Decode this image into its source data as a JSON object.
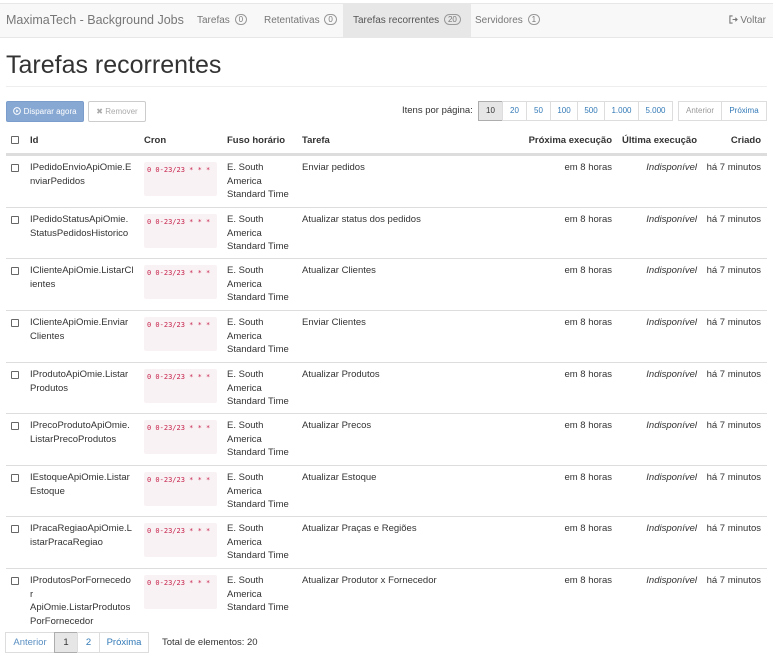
{
  "navbar": {
    "brand": "MaximaTech - Background Jobs",
    "items": [
      {
        "label": "Tarefas",
        "count": "0"
      },
      {
        "label": "Retentativas",
        "count": "0"
      },
      {
        "label": "Tarefas recorrentes",
        "count": "20"
      },
      {
        "label": "Servidores",
        "count": "1"
      }
    ],
    "back_icon": "sign-out-icon",
    "back_label": "Voltar"
  },
  "page": {
    "title": "Tarefas recorrentes"
  },
  "toolbar": {
    "trigger_icon": "play-circle-icon",
    "trigger_label": "Disparar agora",
    "remove_icon": "close-icon",
    "remove_label": "Remover",
    "per_page_label": "Itens por página:",
    "per_page_options": [
      "10",
      "20",
      "50",
      "100",
      "500",
      "1.000",
      "5.000"
    ],
    "per_page_selected": "10",
    "prev_label": "Anterior",
    "next_label": "Próxima"
  },
  "table": {
    "columns": [
      "Id",
      "Cron",
      "Fuso horário",
      "Tarefa",
      "Próxima execução",
      "Última execução",
      "Criado"
    ],
    "rows": [
      {
        "id": "IPedidoEnvioApiOmie.EnviarPedidos",
        "cron": "0 0-23/23 * * *",
        "tz": "E. South America Standard Time",
        "task": "Enviar pedidos",
        "next": "em 8 horas",
        "last": "Indisponível",
        "created": "há 7 minutos"
      },
      {
        "id": "IPedidoStatusApiOmie.StatusPedidosHistorico",
        "cron": "0 0-23/23 * * *",
        "tz": "E. South America Standard Time",
        "task": "Atualizar status dos pedidos",
        "next": "em 8 horas",
        "last": "Indisponível",
        "created": "há 7 minutos"
      },
      {
        "id": "IClienteApiOmie.ListarClientes",
        "cron": "0 0-23/23 * * *",
        "tz": "E. South America Standard Time",
        "task": "Atualizar Clientes",
        "next": "em 8 horas",
        "last": "Indisponível",
        "created": "há 7 minutos"
      },
      {
        "id": "IClienteApiOmie.EnviarClientes",
        "cron": "0 0-23/23 * * *",
        "tz": "E. South America Standard Time",
        "task": "Enviar Clientes",
        "next": "em 8 horas",
        "last": "Indisponível",
        "created": "há 7 minutos"
      },
      {
        "id": "IProdutoApiOmie.ListarProdutos",
        "cron": "0 0-23/23 * * *",
        "tz": "E. South America Standard Time",
        "task": "Atualizar Produtos",
        "next": "em 8 horas",
        "last": "Indisponível",
        "created": "há 7 minutos"
      },
      {
        "id": "IPrecoProdutoApiOmie.ListarPrecoProdutos",
        "cron": "0 0-23/23 * * *",
        "tz": "E. South America Standard Time",
        "task": "Atualizar Precos",
        "next": "em 8 horas",
        "last": "Indisponível",
        "created": "há 7 minutos"
      },
      {
        "id": "IEstoqueApiOmie.ListarEstoque",
        "cron": "0 0-23/23 * * *",
        "tz": "E. South America Standard Time",
        "task": "Atualizar Estoque",
        "next": "em 8 horas",
        "last": "Indisponível",
        "created": "há 7 minutos"
      },
      {
        "id": "IPracaRegiaoApiOmie.ListarPracaRegiao",
        "cron": "0 0-23/23 * * *",
        "tz": "E. South America Standard Time",
        "task": "Atualizar Praças e Regiões",
        "next": "em 8 horas",
        "last": "Indisponível",
        "created": "há 7 minutos"
      },
      {
        "id": "IProdutosPorFornecedorApiOmie.ListarProdutosPorFornecedor",
        "id_lines": [
          "IProdutosPorFornecedor",
          "ApiOmie.ListarProdutos",
          "PorFornecedor"
        ],
        "cron": "0 0-23/23 * * *",
        "tz": "E. South America Standard Time",
        "task": "Atualizar Produtor x Fornecedor",
        "next": "em 8 horas",
        "last": "Indisponível",
        "created": "há 7 minutos"
      }
    ]
  },
  "pager": {
    "prev_label": "Anterior",
    "pages": [
      "1",
      "2"
    ],
    "current": "1",
    "next_label": "Próxima",
    "total_label": "Total de elementos: 20"
  }
}
